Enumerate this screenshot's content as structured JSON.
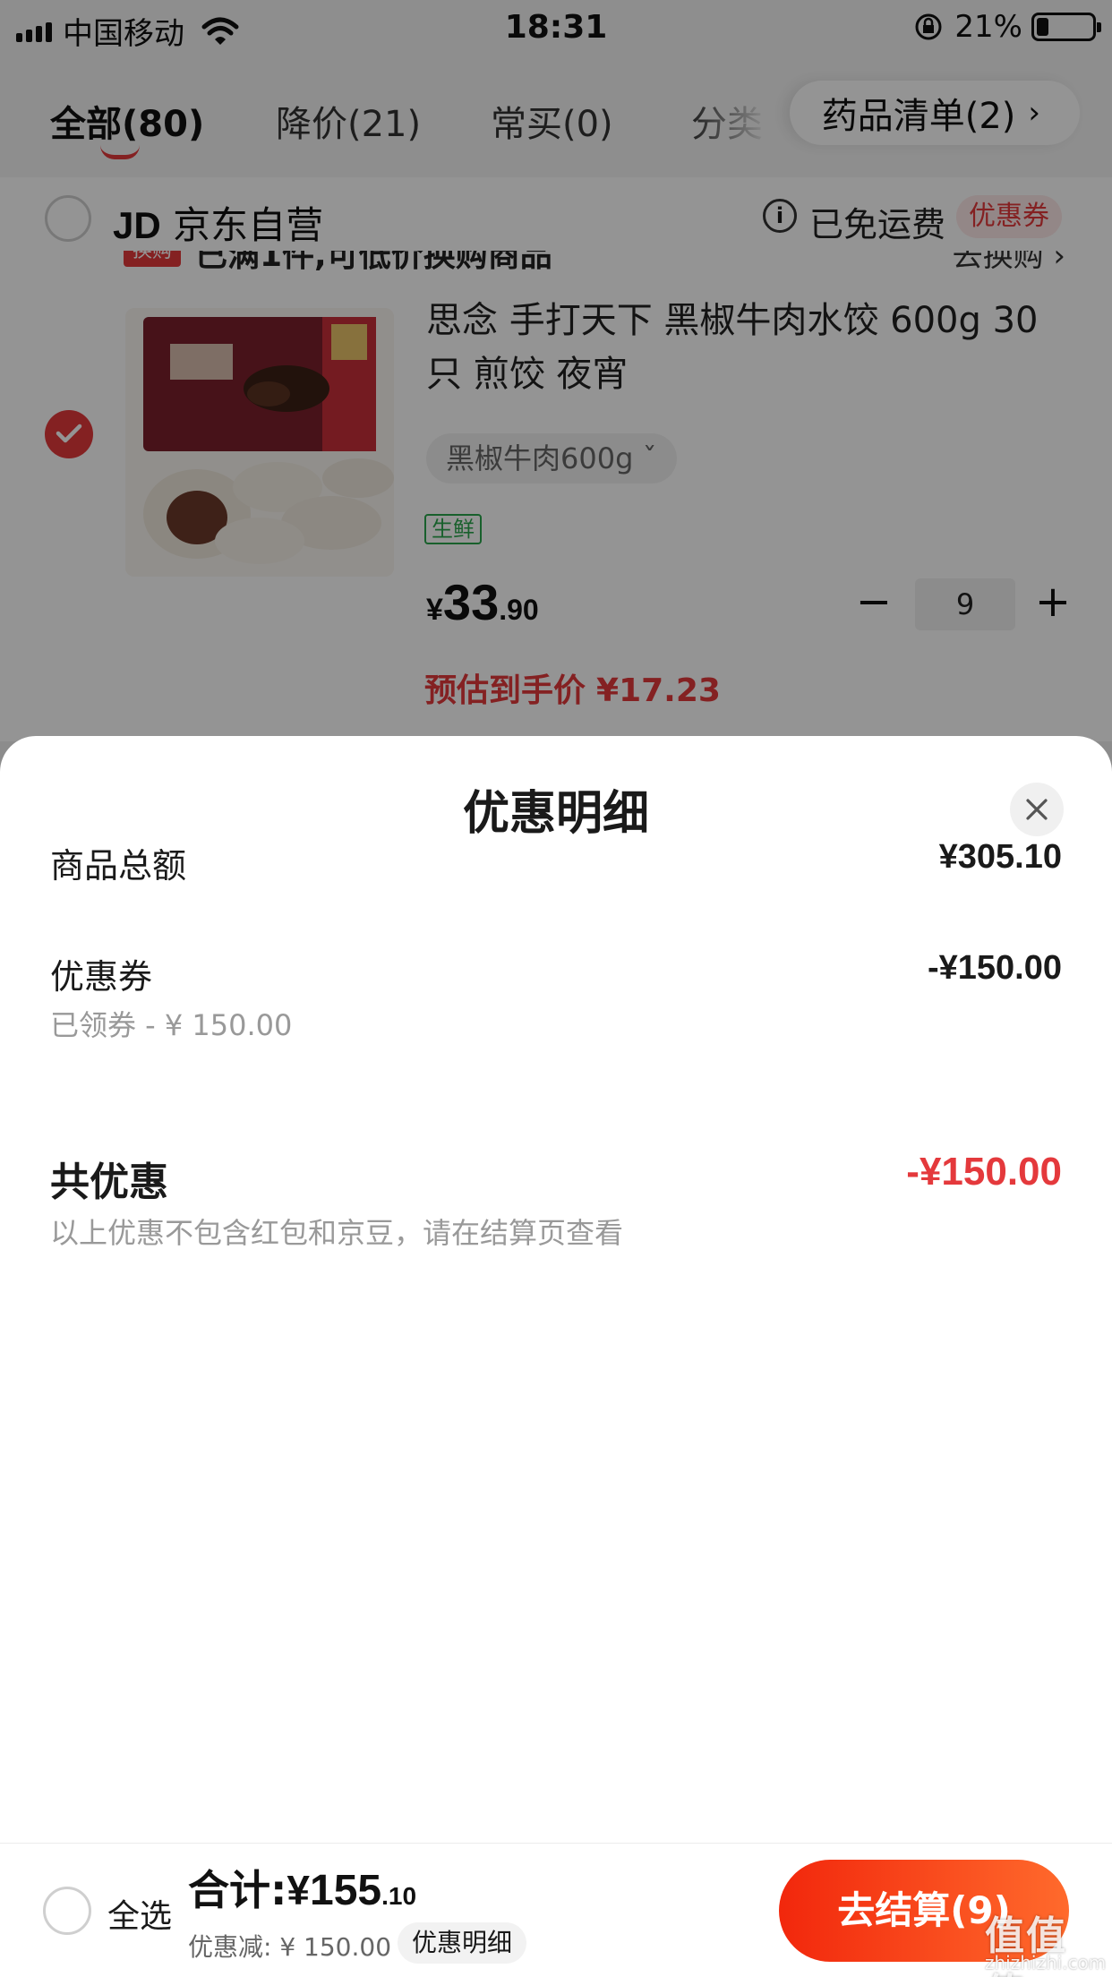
{
  "status_bar": {
    "carrier": "中国移动",
    "time": "18:31",
    "battery_percent": "21%",
    "battery_level": 0.21
  },
  "tabs": {
    "all": "全部(80)",
    "price_drop": "降价(21)",
    "frequent": "常买(0)",
    "category": "分类",
    "medicine_list": "药品清单(2)",
    "medicine_chevron": "›"
  },
  "shop": {
    "logo": "JD",
    "name": "京东自营",
    "shipping": "已免运费",
    "coupon": "优惠券"
  },
  "promo": {
    "tag": "换购",
    "text": "已满1件,可低价换购商品",
    "link": "去换购 ›"
  },
  "product": {
    "title": "思念 手打天下 黑椒牛肉水饺 600g 30只 煎饺 夜宵",
    "spec": "黑椒牛肉600g ˇ",
    "tag": "生鲜",
    "price_currency": "¥",
    "price_integer": "33",
    "price_decimal": ".90",
    "quantity": "9",
    "est_label": "预估到手价",
    "est_value": "¥17.23"
  },
  "sheet": {
    "title": "优惠明细",
    "goods_total_label": "商品总额",
    "goods_total_value": "¥305.10",
    "coupon_label": "优惠券",
    "coupon_value": "-¥150.00",
    "coupon_sub": "已领券 - ¥ 150.00",
    "total_label": "共优惠",
    "total_value": "-¥150.00",
    "note": "以上优惠不包含红包和京豆，请在结算页查看"
  },
  "bottom": {
    "select_all": "全选",
    "sum_label": "合计:",
    "sum_currency": "¥",
    "sum_integer": "155",
    "sum_decimal": ".10",
    "discount": "优惠减: ¥ 150.00",
    "detail": "优惠明细",
    "checkout": "去结算(9)"
  },
  "watermark": {
    "glyphs": "值值值",
    "text": "zhizhizhi.com"
  },
  "colors": {
    "accent": "#e4393c",
    "checkout_start": "#f2270c",
    "checkout_end": "#ff6a2c",
    "fresh_green": "#2aa64c"
  }
}
